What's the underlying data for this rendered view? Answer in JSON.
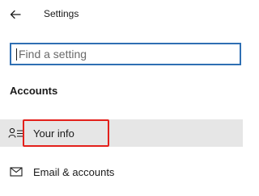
{
  "window": {
    "title": "Settings",
    "back_icon": "back-arrow-icon"
  },
  "search": {
    "placeholder": "Find a setting",
    "value": ""
  },
  "section": {
    "heading": "Accounts"
  },
  "nav_items": [
    {
      "label": "Your info",
      "icon": "person-info-icon",
      "selected": true
    },
    {
      "label": "Email & accounts",
      "icon": "mail-icon",
      "selected": false
    }
  ],
  "annotation": {
    "highlight_color": "#e3201b",
    "target": "Your info"
  },
  "colors": {
    "accent": "#2f6fb3",
    "selected_bg": "#e6e6e6",
    "text": "#1a1a1a"
  }
}
